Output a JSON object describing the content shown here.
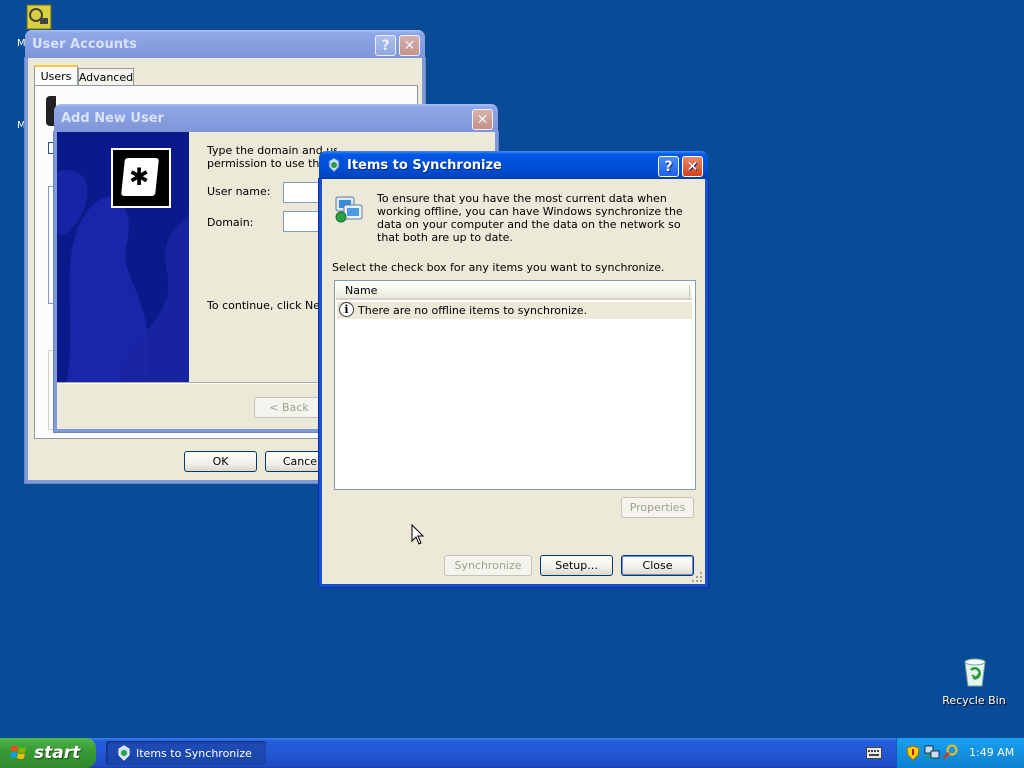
{
  "desktop": {
    "recycle_bin_label": "Recycle Bin"
  },
  "user_accounts": {
    "title": "User Accounts",
    "tabs": [
      "Users",
      "Advanced"
    ],
    "ok_label": "OK",
    "cancel_label": "Cancel"
  },
  "add_new_user": {
    "title": "Add New User",
    "intro_line1": "Type the domain and user name of a user to give them",
    "intro_line2": "permission to use this co",
    "username_label": "User name:",
    "domain_label": "Domain:",
    "continue_text": "To continue, click Next.",
    "back_label": "< Back"
  },
  "sync": {
    "title": "Items to Synchronize",
    "description": "To ensure that you have the most current data when working offline, you can have Windows synchronize the data on your computer and the data on the network so that both are up to date.",
    "instruction": "Select the check box for any items you want to synchronize.",
    "column_name": "Name",
    "empty_message": "There are no offline items to synchronize.",
    "properties_label": "Properties",
    "synchronize_label": "Synchronize",
    "setup_label": "Setup...",
    "close_label": "Close"
  },
  "taskbar": {
    "start_label": "start",
    "task_label": "Items to Synchronize",
    "clock": "1:49 AM"
  },
  "colors": {
    "desktop": "#0a4b98",
    "titlebar_active": "#0050d8",
    "start_green": "#3a9a35",
    "tray_blue": "#1290e0"
  }
}
